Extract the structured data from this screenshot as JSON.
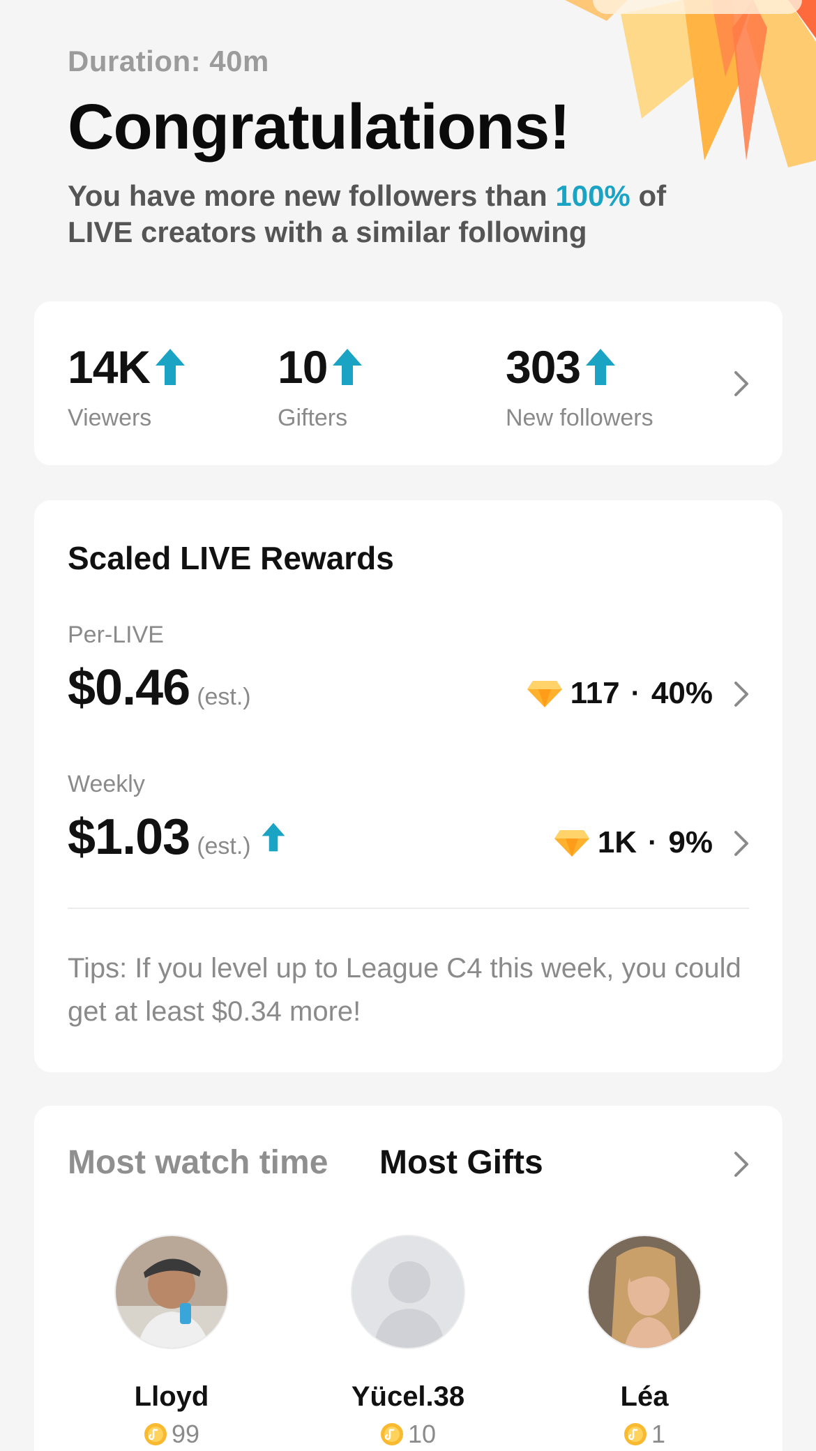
{
  "header": {
    "duration": "Duration: 40m",
    "title": "Congratulations!",
    "subtitle_pre": "You have more new followers than ",
    "subtitle_percent": "100%",
    "subtitle_post": " of LIVE creators with a similar following"
  },
  "stats": [
    {
      "value": "14K",
      "label": "Viewers",
      "trend": "up"
    },
    {
      "value": "10",
      "label": "Gifters",
      "trend": "up"
    },
    {
      "value": "303",
      "label": "New followers",
      "trend": "up"
    }
  ],
  "rewards": {
    "title": "Scaled LIVE Rewards",
    "per_live": {
      "label": "Per-LIVE",
      "amount": "$0.46",
      "est": "(est.)",
      "gems": "117",
      "percent": "40%"
    },
    "weekly": {
      "label": "Weekly",
      "amount": "$1.03",
      "est": "(est.)",
      "trend": "up",
      "gems": "1K",
      "percent": "9%"
    },
    "separator": "·",
    "tips": "Tips: If you level up to League C4 this week, you could get at least $0.34 more!"
  },
  "top_viewers": {
    "tabs": [
      {
        "label": "Most watch time",
        "active": false
      },
      {
        "label": "Most Gifts",
        "active": true
      }
    ],
    "users": [
      {
        "name": "Lloyd",
        "coins": "99"
      },
      {
        "name": "Yücel.38",
        "coins": "10"
      },
      {
        "name": "Léa",
        "coins": "1"
      }
    ]
  },
  "colors": {
    "accent": "#1aa3c2",
    "background": "#f5f5f6",
    "card": "#ffffff",
    "muted": "#8a8a8a"
  },
  "icons": [
    "up-arrow-icon",
    "chevron-right-icon",
    "gem-icon",
    "coin-icon",
    "avatar-placeholder-icon"
  ]
}
